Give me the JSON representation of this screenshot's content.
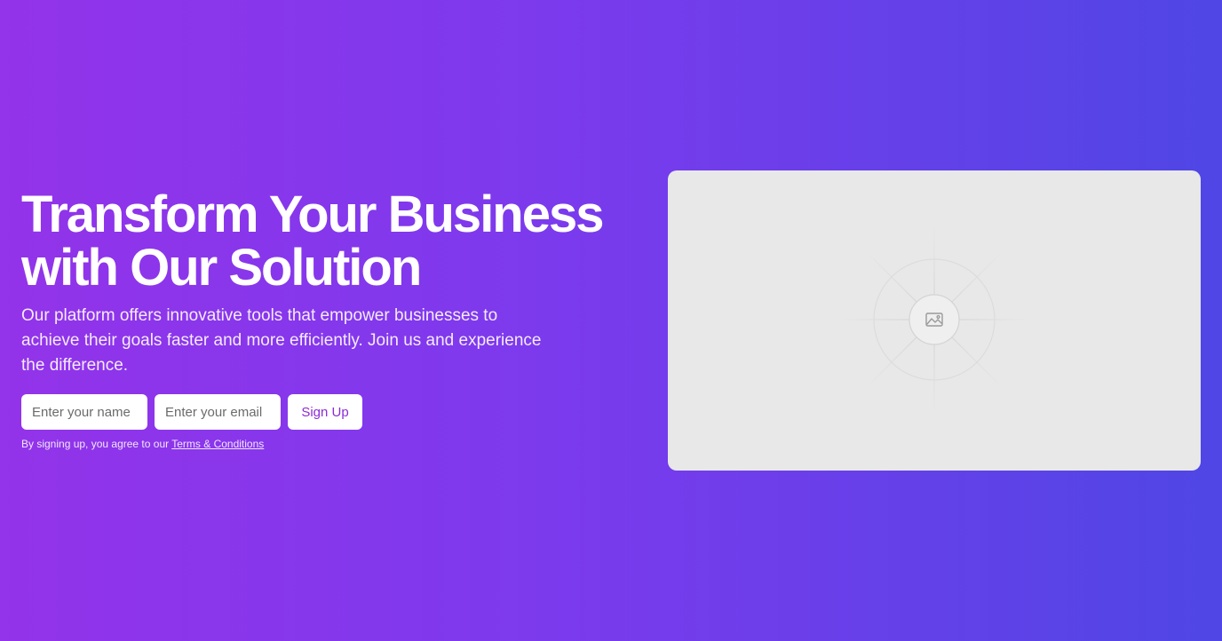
{
  "hero": {
    "headline_line1": "Transform Your Business",
    "headline_line2": "with Our Solution",
    "subtext": "Our platform offers innovative tools that empower businesses to achieve their goals faster and more efficiently. Join us and experience the difference."
  },
  "form": {
    "name_placeholder": "Enter your name",
    "email_placeholder": "Enter your email",
    "name_value": "",
    "email_value": "",
    "submit_label": "Sign Up"
  },
  "legal": {
    "prefix": "By signing up, you agree to our ",
    "link_text": "Terms & Conditions"
  },
  "media": {
    "icon": "image-placeholder-icon"
  },
  "colors": {
    "gradient_start": "#9333ea",
    "gradient_end": "#4f46e5",
    "button_text": "#8b2bd6",
    "placeholder_bg": "#e8e8e8"
  }
}
